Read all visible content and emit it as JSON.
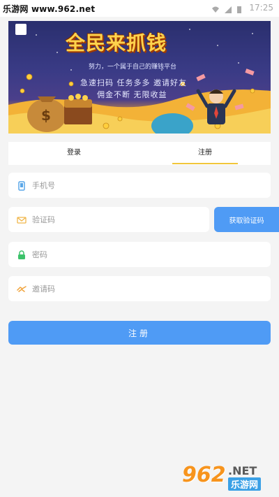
{
  "status_bar": {
    "watermark_text": "乐游网 www.962.net",
    "time": "17:25"
  },
  "banner": {
    "title": "全民来抓钱",
    "subtitle": "努力，一个属于自己的赚钱平台",
    "slogan_line1": "急速扫码  任务多多  邀请好友",
    "slogan_line2": "佣金不断  无限收益"
  },
  "tabs": [
    {
      "label": "登录",
      "active": false
    },
    {
      "label": "注册",
      "active": true
    }
  ],
  "form": {
    "phone_placeholder": "手机号",
    "code_placeholder": "验证码",
    "code_button_label": "获取验证码",
    "password_placeholder": "密码",
    "invite_placeholder": "邀请码",
    "submit_label": "注册"
  },
  "watermark": {
    "number": "962",
    "suffix": ".NET",
    "name": "乐游网"
  },
  "colors": {
    "primary_blue": "#4f9bf5",
    "tab_underline": "#f1c63a",
    "page_bg": "#f4f4f4"
  },
  "icons": {
    "phone": "phone-icon",
    "code": "envelope-icon",
    "password": "lock-icon",
    "invite": "handshake-icon"
  }
}
